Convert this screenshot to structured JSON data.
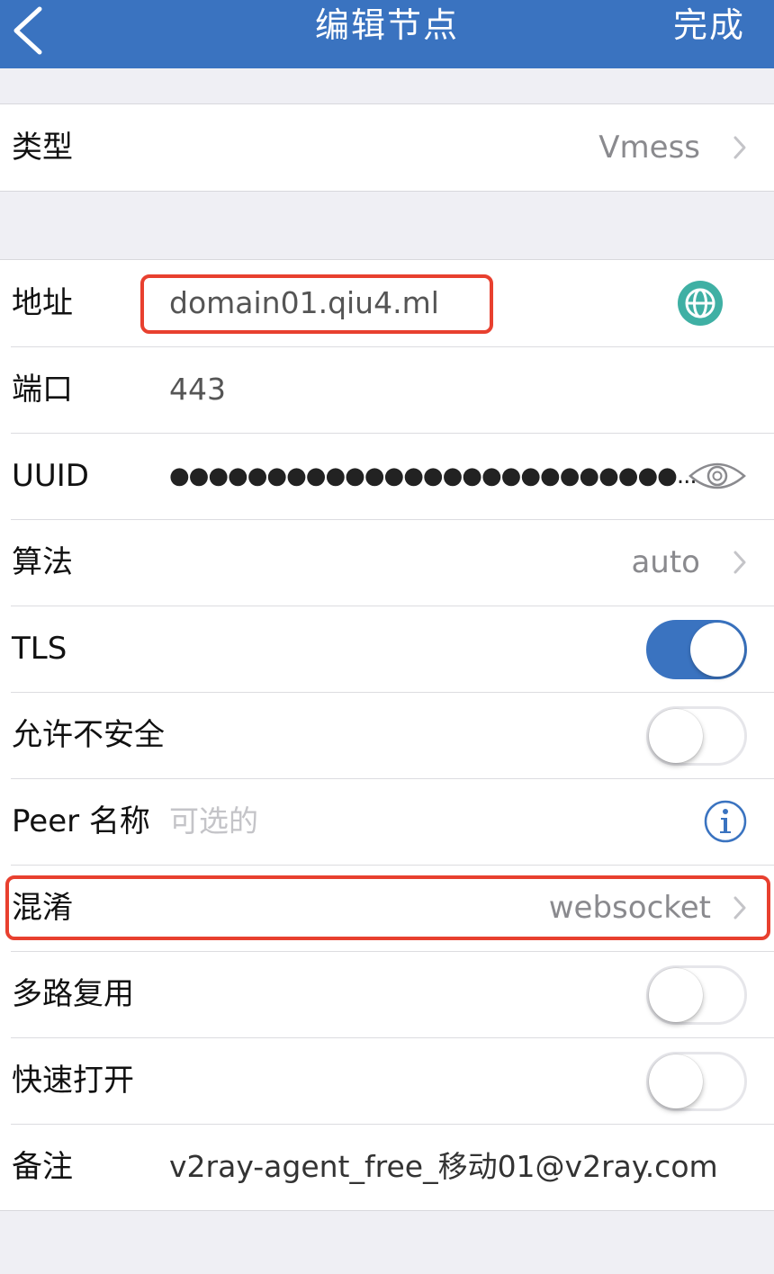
{
  "nav": {
    "back_icon": "chevron-left-icon",
    "title": "编辑节点",
    "done_label": "完成"
  },
  "type_row": {
    "label": "类型",
    "value": "Vmess"
  },
  "fields": {
    "address": {
      "label": "地址",
      "value": "domain01.qiu4.ml",
      "icon": "globe-icon"
    },
    "port": {
      "label": "端口",
      "value": "443"
    },
    "uuid": {
      "label": "UUID",
      "value": "●●●●●●●●●●●●●●●●●●●●●●●●●●...",
      "icon": "eye-icon"
    },
    "cipher": {
      "label": "算法",
      "value": "auto"
    },
    "tls": {
      "label": "TLS",
      "on": true
    },
    "allow_insecure": {
      "label": "允许不安全",
      "on": false
    },
    "peer_name": {
      "label": "Peer 名称",
      "placeholder": "可选的",
      "icon": "info-icon"
    },
    "obfs": {
      "label": "混淆",
      "value": "websocket"
    },
    "mux": {
      "label": "多路复用",
      "on": false
    },
    "fast_open": {
      "label": "快速打开",
      "on": false
    },
    "remark": {
      "label": "备注",
      "value": "v2ray-agent_free_移动01@v2ray.com"
    }
  },
  "colors": {
    "accent": "#3a73c0",
    "highlight": "#e8402f",
    "globe": "#3fb0a4",
    "background": "#efeff4"
  }
}
